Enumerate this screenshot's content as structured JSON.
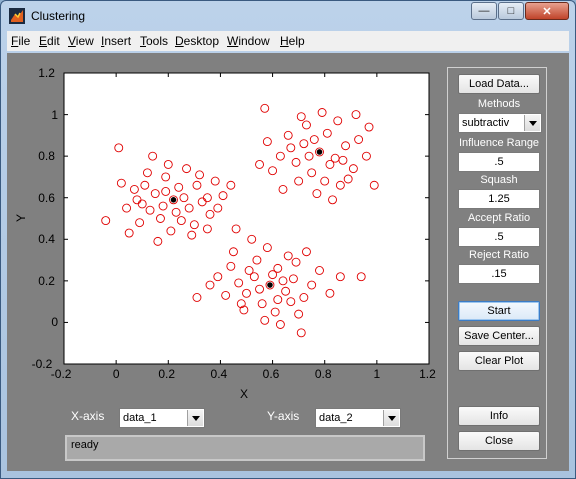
{
  "window": {
    "title": "Clustering"
  },
  "menu": [
    {
      "key": "F",
      "rest": "ile"
    },
    {
      "key": "E",
      "rest": "dit"
    },
    {
      "key": "V",
      "rest": "iew"
    },
    {
      "key": "I",
      "rest": "nsert"
    },
    {
      "key": "T",
      "rest": "ools"
    },
    {
      "key": "D",
      "rest": "esktop"
    },
    {
      "key": "W",
      "rest": "indow"
    },
    {
      "key": "H",
      "rest": "elp"
    }
  ],
  "controls": {
    "load_data": "Load Data...",
    "methods_label": "Methods",
    "methods_value": "subtractiv",
    "influence_label": "Influence Range",
    "influence_value": ".5",
    "squash_label": "Squash",
    "squash_value": "1.25",
    "accept_label": "Accept Ratio",
    "accept_value": ".5",
    "reject_label": "Reject Ratio",
    "reject_value": ".15",
    "start": "Start",
    "save_center": "Save Center...",
    "clear_plot": "Clear Plot",
    "info": "Info",
    "close": "Close"
  },
  "axis_selectors": {
    "x_label": "X-axis",
    "x_value": "data_1",
    "y_label": "Y-axis",
    "y_value": "data_2"
  },
  "status": "ready",
  "colors": {
    "points": "#e00000",
    "centers": "#000000",
    "panel": "#808080"
  },
  "chart_data": {
    "type": "scatter",
    "xlabel": "X",
    "ylabel": "Y",
    "xlim": [
      -0.2,
      1.2
    ],
    "ylim": [
      -0.2,
      1.2
    ],
    "xticks": [
      "-0.2",
      "0",
      "0.2",
      "0.4",
      "0.6",
      "0.8",
      "1",
      "1.2"
    ],
    "yticks": [
      "-0.2",
      "0",
      "0.2",
      "0.4",
      "0.6",
      "0.8",
      "1",
      "1.2"
    ],
    "grid": false,
    "cluster_centers": [
      {
        "x": 0.22,
        "y": 0.59
      },
      {
        "x": 0.78,
        "y": 0.82
      },
      {
        "x": 0.59,
        "y": 0.18
      }
    ],
    "points": [
      {
        "x": 0.22,
        "y": 0.59
      },
      {
        "x": 0.15,
        "y": 0.62
      },
      {
        "x": 0.28,
        "y": 0.55
      },
      {
        "x": 0.1,
        "y": 0.57
      },
      {
        "x": 0.31,
        "y": 0.66
      },
      {
        "x": 0.19,
        "y": 0.7
      },
      {
        "x": 0.25,
        "y": 0.49
      },
      {
        "x": 0.07,
        "y": 0.64
      },
      {
        "x": 0.35,
        "y": 0.6
      },
      {
        "x": 0.17,
        "y": 0.5
      },
      {
        "x": 0.12,
        "y": 0.72
      },
      {
        "x": 0.27,
        "y": 0.74
      },
      {
        "x": 0.04,
        "y": 0.55
      },
      {
        "x": 0.36,
        "y": 0.52
      },
      {
        "x": 0.21,
        "y": 0.44
      },
      {
        "x": 0.14,
        "y": 0.8
      },
      {
        "x": 0.3,
        "y": 0.47
      },
      {
        "x": 0.09,
        "y": 0.48
      },
      {
        "x": 0.38,
        "y": 0.68
      },
      {
        "x": 0.24,
        "y": 0.65
      },
      {
        "x": 0.18,
        "y": 0.56
      },
      {
        "x": 0.33,
        "y": 0.58
      },
      {
        "x": 0.11,
        "y": 0.66
      },
      {
        "x": 0.26,
        "y": 0.6
      },
      {
        "x": 0.05,
        "y": 0.43
      },
      {
        "x": 0.16,
        "y": 0.39
      },
      {
        "x": 0.41,
        "y": 0.61
      },
      {
        "x": 0.29,
        "y": 0.42
      },
      {
        "x": 0.02,
        "y": 0.67
      },
      {
        "x": 0.2,
        "y": 0.76
      },
      {
        "x": 0.35,
        "y": 0.45
      },
      {
        "x": 0.08,
        "y": 0.59
      },
      {
        "x": 0.23,
        "y": 0.53
      },
      {
        "x": 0.13,
        "y": 0.54
      },
      {
        "x": 0.32,
        "y": 0.71
      },
      {
        "x": -0.04,
        "y": 0.49
      },
      {
        "x": 0.01,
        "y": 0.84
      },
      {
        "x": 0.39,
        "y": 0.55
      },
      {
        "x": 0.44,
        "y": 0.66
      },
      {
        "x": 0.19,
        "y": 0.63
      },
      {
        "x": 0.78,
        "y": 0.82
      },
      {
        "x": 0.72,
        "y": 0.86
      },
      {
        "x": 0.84,
        "y": 0.79
      },
      {
        "x": 0.69,
        "y": 0.77
      },
      {
        "x": 0.81,
        "y": 0.91
      },
      {
        "x": 0.75,
        "y": 0.72
      },
      {
        "x": 0.88,
        "y": 0.85
      },
      {
        "x": 0.66,
        "y": 0.9
      },
      {
        "x": 0.8,
        "y": 0.68
      },
      {
        "x": 0.91,
        "y": 0.74
      },
      {
        "x": 0.73,
        "y": 0.95
      },
      {
        "x": 0.85,
        "y": 0.97
      },
      {
        "x": 0.63,
        "y": 0.8
      },
      {
        "x": 0.77,
        "y": 0.62
      },
      {
        "x": 0.93,
        "y": 0.88
      },
      {
        "x": 0.7,
        "y": 0.68
      },
      {
        "x": 0.86,
        "y": 0.66
      },
      {
        "x": 0.6,
        "y": 0.73
      },
      {
        "x": 0.79,
        "y": 1.01
      },
      {
        "x": 0.96,
        "y": 0.8
      },
      {
        "x": 0.67,
        "y": 0.84
      },
      {
        "x": 0.82,
        "y": 0.76
      },
      {
        "x": 0.74,
        "y": 0.8
      },
      {
        "x": 0.89,
        "y": 0.69
      },
      {
        "x": 0.64,
        "y": 0.64
      },
      {
        "x": 0.58,
        "y": 0.87
      },
      {
        "x": 0.97,
        "y": 0.94
      },
      {
        "x": 0.76,
        "y": 0.88
      },
      {
        "x": 0.83,
        "y": 0.59
      },
      {
        "x": 0.71,
        "y": 0.99
      },
      {
        "x": 0.99,
        "y": 0.66
      },
      {
        "x": 0.57,
        "y": 1.03
      },
      {
        "x": 0.55,
        "y": 0.76
      },
      {
        "x": 0.92,
        "y": 1.0
      },
      {
        "x": 0.87,
        "y": 0.78
      },
      {
        "x": 0.59,
        "y": 0.18
      },
      {
        "x": 0.53,
        "y": 0.22
      },
      {
        "x": 0.65,
        "y": 0.15
      },
      {
        "x": 0.5,
        "y": 0.14
      },
      {
        "x": 0.62,
        "y": 0.26
      },
      {
        "x": 0.56,
        "y": 0.09
      },
      {
        "x": 0.68,
        "y": 0.21
      },
      {
        "x": 0.47,
        "y": 0.19
      },
      {
        "x": 0.61,
        "y": 0.05
      },
      {
        "x": 0.72,
        "y": 0.12
      },
      {
        "x": 0.54,
        "y": 0.3
      },
      {
        "x": 0.66,
        "y": 0.32
      },
      {
        "x": 0.44,
        "y": 0.27
      },
      {
        "x": 0.58,
        "y": 0.36
      },
      {
        "x": 0.75,
        "y": 0.18
      },
      {
        "x": 0.49,
        "y": 0.06
      },
      {
        "x": 0.63,
        "y": -0.01
      },
      {
        "x": 0.42,
        "y": 0.13
      },
      {
        "x": 0.7,
        "y": 0.04
      },
      {
        "x": 0.52,
        "y": 0.4
      },
      {
        "x": 0.78,
        "y": 0.25
      },
      {
        "x": 0.39,
        "y": 0.22
      },
      {
        "x": 0.57,
        "y": 0.01
      },
      {
        "x": 0.67,
        "y": 0.1
      },
      {
        "x": 0.45,
        "y": 0.34
      },
      {
        "x": 0.6,
        "y": 0.23
      },
      {
        "x": 0.55,
        "y": 0.16
      },
      {
        "x": 0.64,
        "y": 0.2
      },
      {
        "x": 0.51,
        "y": 0.25
      },
      {
        "x": 0.69,
        "y": 0.29
      },
      {
        "x": 0.31,
        "y": 0.12
      },
      {
        "x": 0.82,
        "y": 0.14
      },
      {
        "x": 0.46,
        "y": 0.45
      },
      {
        "x": 0.73,
        "y": 0.34
      },
      {
        "x": 0.86,
        "y": 0.22
      },
      {
        "x": 0.48,
        "y": 0.09
      },
      {
        "x": 0.62,
        "y": 0.11
      },
      {
        "x": 0.36,
        "y": 0.18
      },
      {
        "x": 0.71,
        "y": -0.05
      },
      {
        "x": 0.94,
        "y": 0.22
      }
    ]
  }
}
